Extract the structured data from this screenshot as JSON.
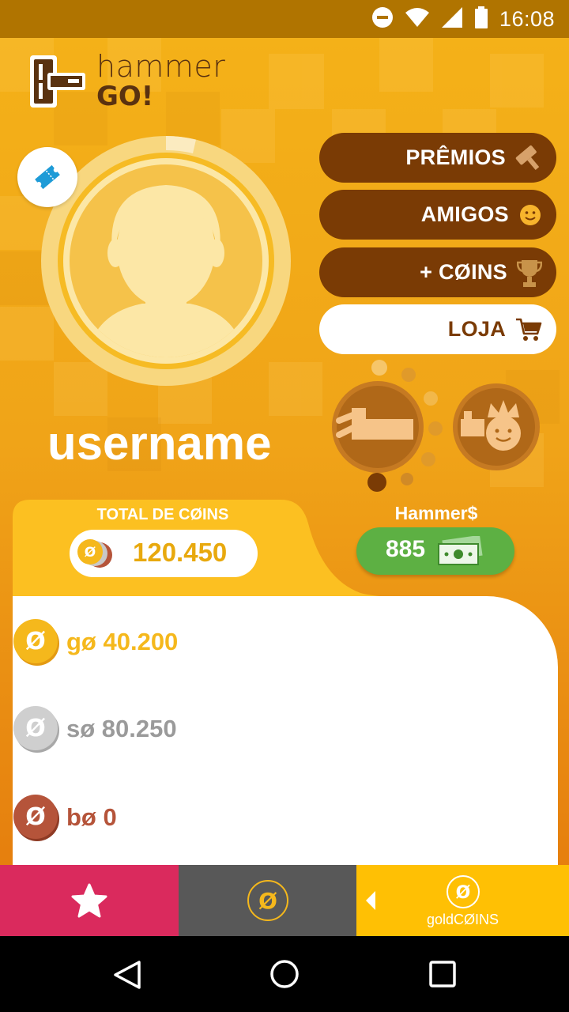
{
  "status_bar": {
    "time": "16:08"
  },
  "logo": {
    "line1": "hammer",
    "line2": "GO!"
  },
  "profile": {
    "username": "username"
  },
  "menu": [
    {
      "label": "PRÊMIOS",
      "icon": "hammer-icon"
    },
    {
      "label": "AMIGOS",
      "icon": "smiley-icon"
    },
    {
      "label": "+ CØINS",
      "icon": "trophy-icon"
    },
    {
      "label": "LOJA",
      "icon": "cart-icon"
    }
  ],
  "totals": {
    "total_label": "TOTAL DE CØINS",
    "total_value": "120.450",
    "hammer_label": "Hammer$",
    "hammer_value": "885"
  },
  "coins": [
    {
      "label": "gø 40.200",
      "color": "#F5B81C"
    },
    {
      "label": "sø 80.250",
      "color": "#9A9A9A"
    },
    {
      "label": "bø 0",
      "color": "#B5543A"
    }
  ],
  "bottom_tabs": {
    "gold_label": "goldCØINS"
  },
  "colors": {
    "accent_brown": "#7A3B05",
    "tab_pink": "#DA2A5D",
    "tab_gray": "#585858",
    "tab_gold": "#FFC004",
    "green": "#5DB043"
  }
}
